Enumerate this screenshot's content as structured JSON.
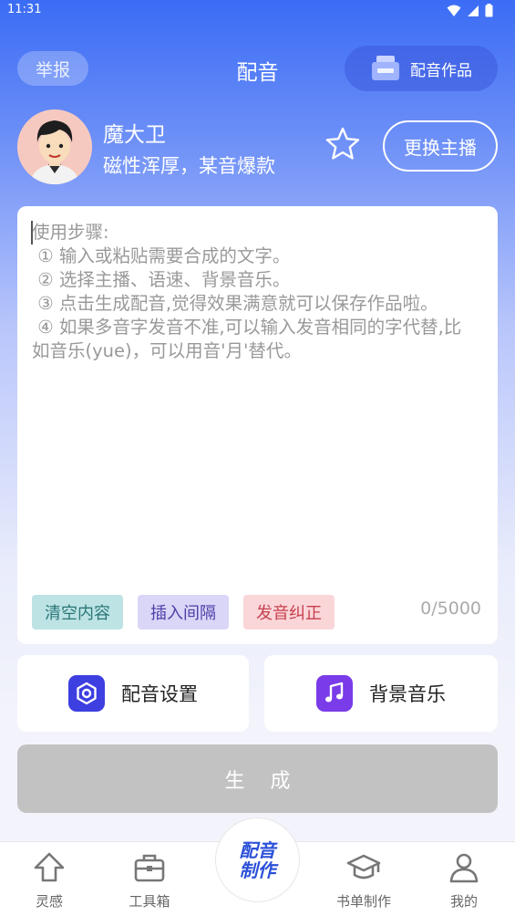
{
  "status_bar": {
    "time": "11:31"
  },
  "header": {
    "report_label": "举报",
    "title": "配音",
    "works_label": "配音作品"
  },
  "anchor": {
    "name": "魔大卫",
    "description": "磁性浑厚，某音爆款",
    "change_label": "更换主播"
  },
  "editor": {
    "placeholder": "使用步骤:\n ① 输入或粘贴需要合成的文字。\n ② 选择主播、语速、背景音乐。\n ③ 点击生成配音,觉得效果满意就可以保存作品啦。\n ④ 如果多音字发音不准,可以输入发音相同的字代替,比如音乐(yue)，可以用音'月'替代。",
    "clear_label": "清空内容",
    "insert_pause_label": "插入间隔",
    "pronunciation_fix_label": "发音纠正",
    "counter": "0/5000"
  },
  "settings": {
    "voice_settings_label": "配音设置",
    "background_music_label": "背景音乐"
  },
  "generate_label": "生成",
  "bottom_nav": {
    "items": [
      {
        "label": "灵感",
        "icon": "arrow-up-icon"
      },
      {
        "label": "工具箱",
        "icon": "toolbox-icon"
      },
      {
        "label": "书单制作",
        "icon": "graduation-cap-icon"
      },
      {
        "label": "我的",
        "icon": "user-icon"
      }
    ],
    "center_line1": "配音",
    "center_line2": "制作"
  },
  "colors": {
    "accent": "#2b50d8",
    "generate_disabled": "#c2c2c2",
    "voice_icon_bg": "#3d3fe0",
    "music_icon_bg": "#7a3be8"
  }
}
